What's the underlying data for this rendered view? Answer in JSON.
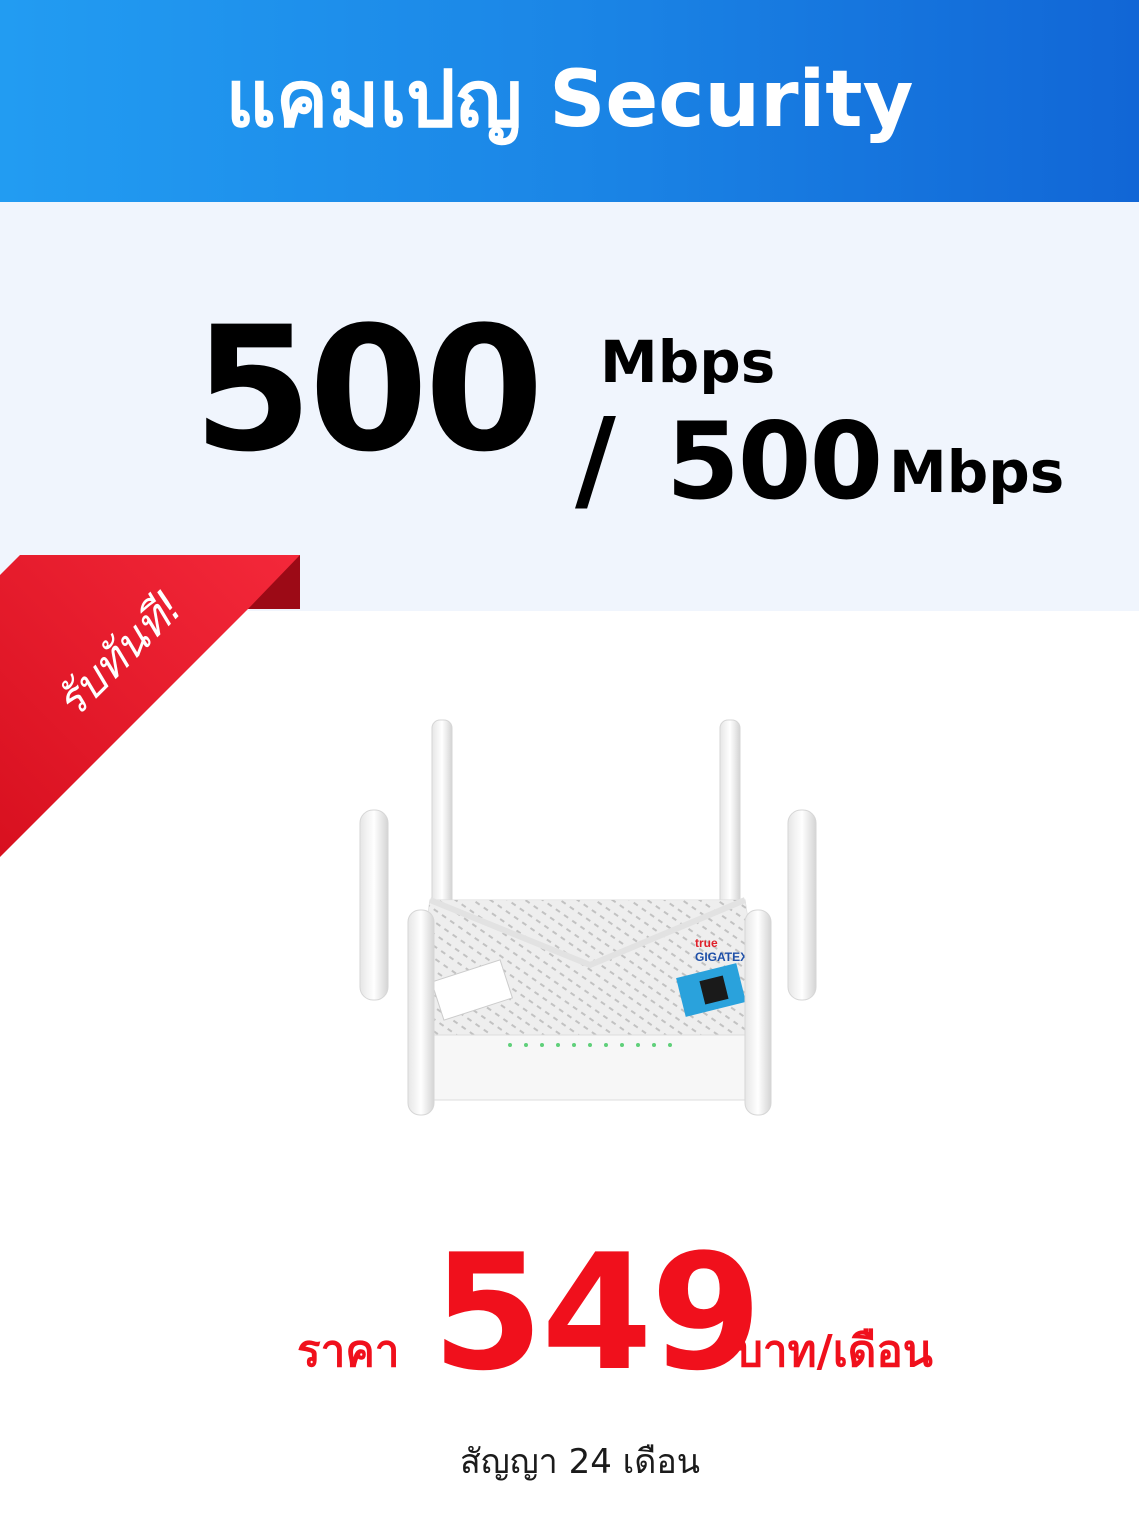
{
  "header": {
    "title": "แคมเปญ Security"
  },
  "speed": {
    "download": "500",
    "download_unit": "Mbps",
    "separator": "/",
    "upload": "500",
    "upload_unit": "Mbps"
  },
  "badge": {
    "label": "รับทันที!"
  },
  "product": {
    "image": "wifi-router-image",
    "brand": "true",
    "model": "GIGATEX"
  },
  "price": {
    "label": "ราคา",
    "value": "549",
    "unit": "บาท/เดือน"
  },
  "contract": {
    "text": "สัญญา 24 เดือน"
  },
  "colors": {
    "header_blue": "#1b86e6",
    "price_red": "#f0101c",
    "ribbon_red": "#e81a2c",
    "band": "#f0f5fd"
  }
}
